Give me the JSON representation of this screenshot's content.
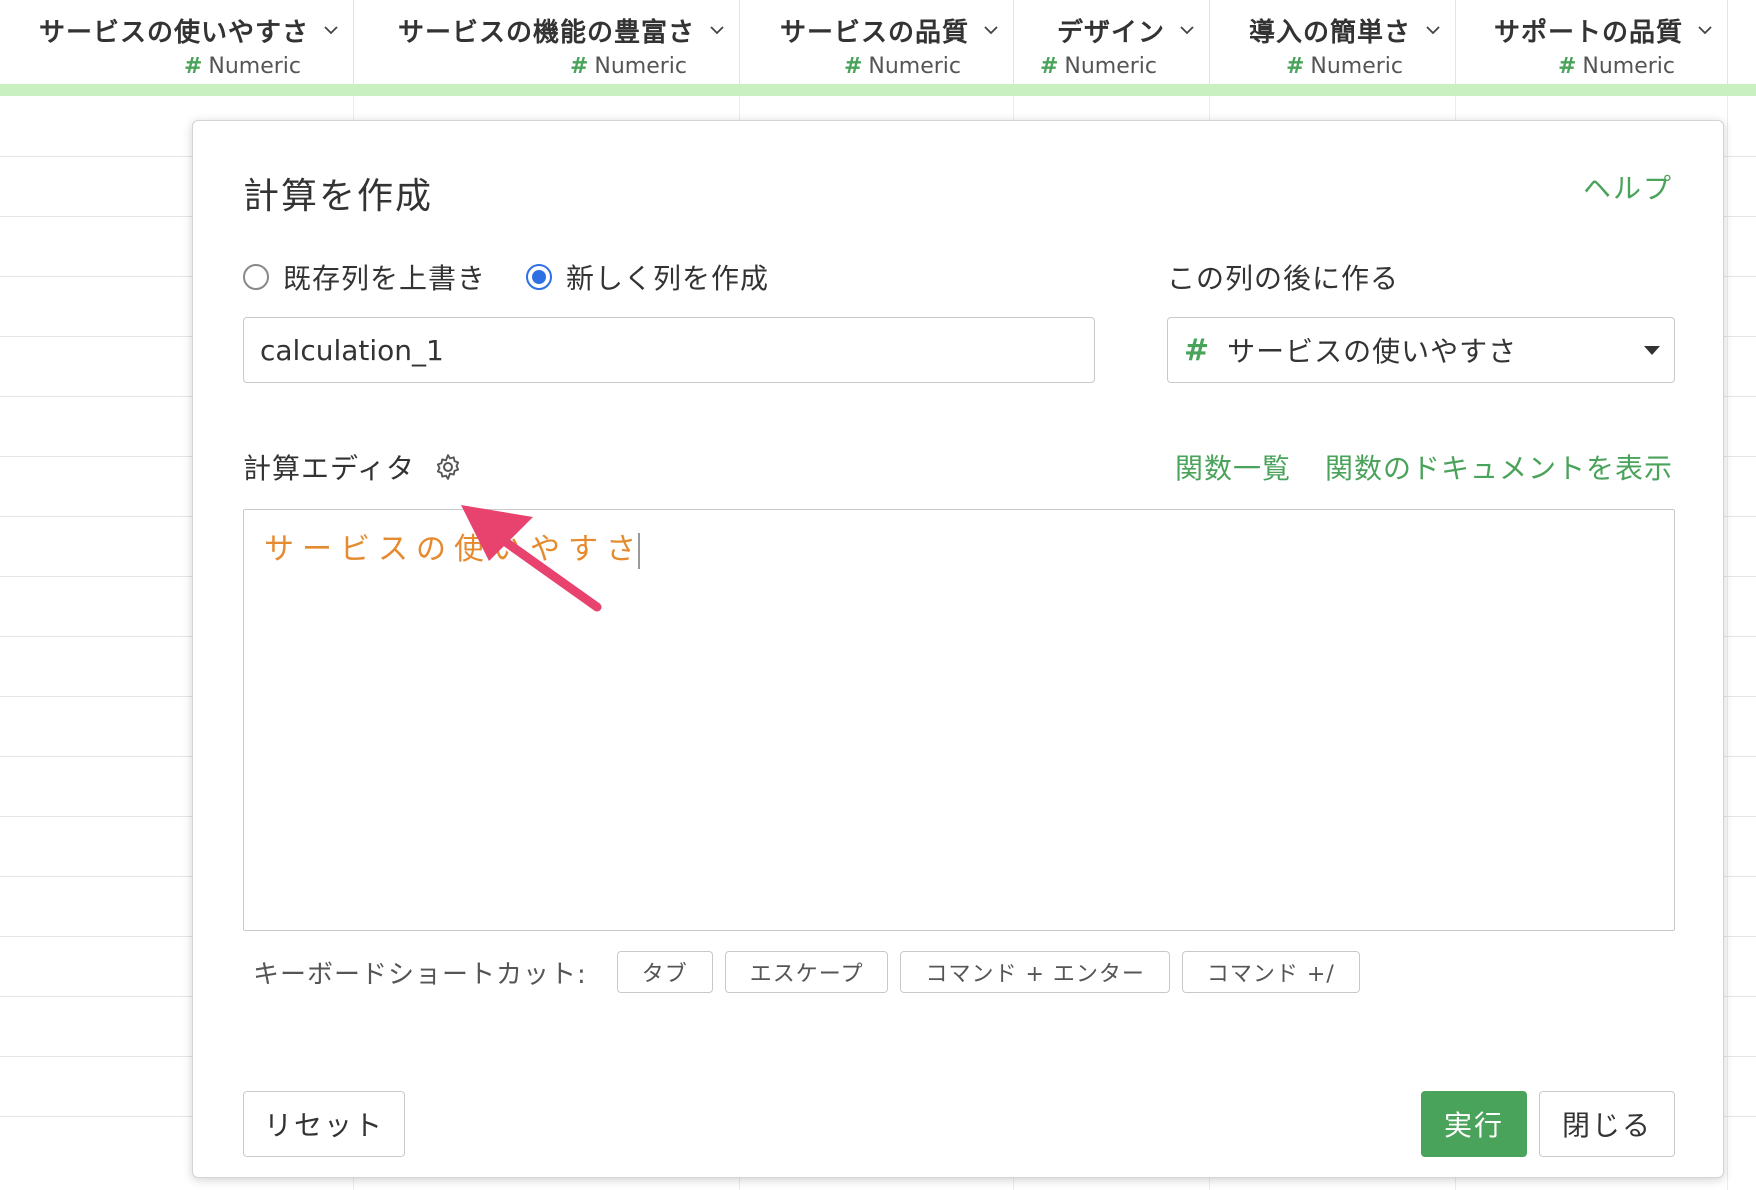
{
  "columns": [
    {
      "name": "サービスの使いやすさ",
      "type": "Numeric"
    },
    {
      "name": "サービスの機能の豊富さ",
      "type": "Numeric"
    },
    {
      "name": "サービスの品質",
      "type": "Numeric"
    },
    {
      "name": "デザイン",
      "type": "Numeric"
    },
    {
      "name": "導入の簡単さ",
      "type": "Numeric"
    },
    {
      "name": "サポートの品質",
      "type": "Numeric"
    }
  ],
  "dialog": {
    "title": "計算を作成",
    "help": "ヘルプ",
    "radio_overwrite": "既存列を上書き",
    "radio_new": "新しく列を作成",
    "selected_mode": "new",
    "after_label": "この列の後に作る",
    "new_column_name": "calculation_1",
    "after_column": "サービスの使いやすさ",
    "editor_label": "計算エディタ",
    "func_list": "関数一覧",
    "func_doc": "関数のドキュメントを表示",
    "editor_text": "サービスの使いやすさ",
    "shortcut_label": "キーボードショートカット:",
    "shortcuts": [
      "タブ",
      "エスケープ",
      "コマンド + エンター",
      "コマンド +/"
    ],
    "reset": "リセット",
    "run": "実行",
    "close": "閉じる"
  },
  "colors": {
    "accent_green": "#4aa35a",
    "editor_text": "#e58a2e",
    "arrow": "#e8436e",
    "radio_selected": "#2f6fe4",
    "header_accent": "#c8f0c0"
  }
}
